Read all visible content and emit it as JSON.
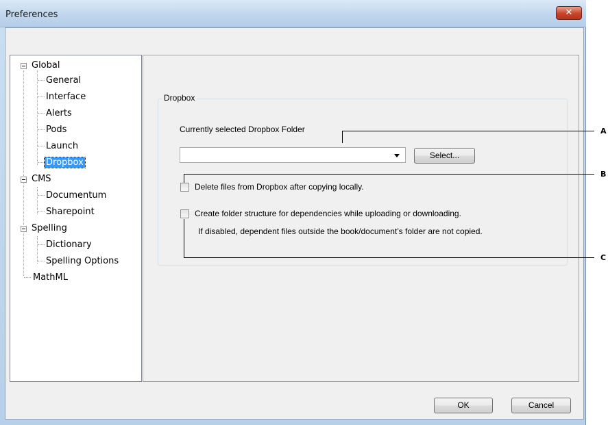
{
  "window": {
    "title": "Preferences",
    "close_symbol": "✕"
  },
  "tree": {
    "items": [
      {
        "label": "Global",
        "expander": "−"
      },
      {
        "label": "General"
      },
      {
        "label": "Interface"
      },
      {
        "label": "Alerts"
      },
      {
        "label": "Pods"
      },
      {
        "label": "Launch"
      },
      {
        "label": "Dropbox",
        "selected": true
      },
      {
        "label": "CMS",
        "expander": "−"
      },
      {
        "label": "Documentum"
      },
      {
        "label": "Sharepoint"
      },
      {
        "label": "Spelling",
        "expander": "−"
      },
      {
        "label": "Dictionary"
      },
      {
        "label": "Spelling Options"
      },
      {
        "label": "MathML"
      }
    ]
  },
  "dropbox": {
    "group_title": "Dropbox",
    "folder_label": "Currently selected Dropbox Folder",
    "folder_value": "",
    "select_button": "Select...",
    "delete_checkbox_label": "Delete files from Dropbox after copying locally.",
    "delete_checked": false,
    "structure_checkbox_label": "Create folder structure for dependencies while uploading or downloading.",
    "structure_checked": false,
    "structure_note": "If disabled, dependent files outside the book/document’s folder are not copied."
  },
  "buttons": {
    "ok": "OK",
    "cancel": "Cancel"
  },
  "callouts": {
    "a": "A",
    "b": "B",
    "c": "C"
  }
}
